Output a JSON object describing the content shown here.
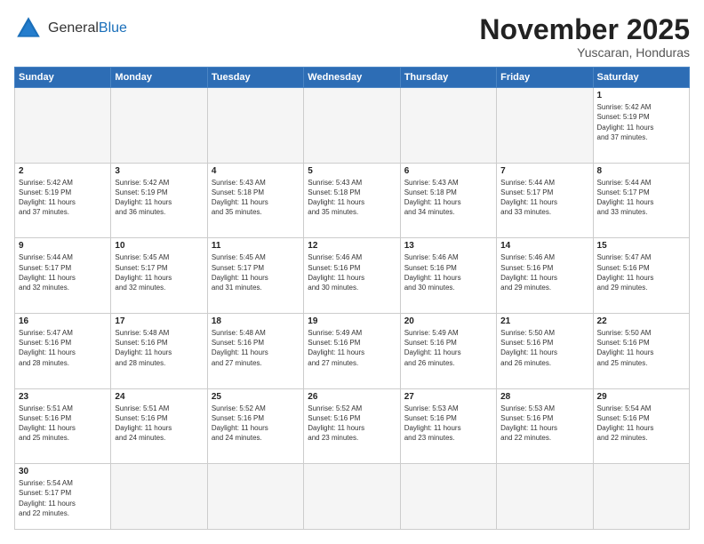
{
  "header": {
    "logo_general": "General",
    "logo_blue": "Blue",
    "month_title": "November 2025",
    "location": "Yuscaran, Honduras"
  },
  "days_of_week": [
    "Sunday",
    "Monday",
    "Tuesday",
    "Wednesday",
    "Thursday",
    "Friday",
    "Saturday"
  ],
  "weeks": [
    [
      {
        "day": "",
        "info": ""
      },
      {
        "day": "",
        "info": ""
      },
      {
        "day": "",
        "info": ""
      },
      {
        "day": "",
        "info": ""
      },
      {
        "day": "",
        "info": ""
      },
      {
        "day": "",
        "info": ""
      },
      {
        "day": "1",
        "info": "Sunrise: 5:42 AM\nSunset: 5:19 PM\nDaylight: 11 hours\nand 37 minutes."
      }
    ],
    [
      {
        "day": "2",
        "info": "Sunrise: 5:42 AM\nSunset: 5:19 PM\nDaylight: 11 hours\nand 37 minutes."
      },
      {
        "day": "3",
        "info": "Sunrise: 5:42 AM\nSunset: 5:19 PM\nDaylight: 11 hours\nand 36 minutes."
      },
      {
        "day": "4",
        "info": "Sunrise: 5:43 AM\nSunset: 5:18 PM\nDaylight: 11 hours\nand 35 minutes."
      },
      {
        "day": "5",
        "info": "Sunrise: 5:43 AM\nSunset: 5:18 PM\nDaylight: 11 hours\nand 35 minutes."
      },
      {
        "day": "6",
        "info": "Sunrise: 5:43 AM\nSunset: 5:18 PM\nDaylight: 11 hours\nand 34 minutes."
      },
      {
        "day": "7",
        "info": "Sunrise: 5:44 AM\nSunset: 5:17 PM\nDaylight: 11 hours\nand 33 minutes."
      },
      {
        "day": "8",
        "info": "Sunrise: 5:44 AM\nSunset: 5:17 PM\nDaylight: 11 hours\nand 33 minutes."
      }
    ],
    [
      {
        "day": "9",
        "info": "Sunrise: 5:44 AM\nSunset: 5:17 PM\nDaylight: 11 hours\nand 32 minutes."
      },
      {
        "day": "10",
        "info": "Sunrise: 5:45 AM\nSunset: 5:17 PM\nDaylight: 11 hours\nand 32 minutes."
      },
      {
        "day": "11",
        "info": "Sunrise: 5:45 AM\nSunset: 5:17 PM\nDaylight: 11 hours\nand 31 minutes."
      },
      {
        "day": "12",
        "info": "Sunrise: 5:46 AM\nSunset: 5:16 PM\nDaylight: 11 hours\nand 30 minutes."
      },
      {
        "day": "13",
        "info": "Sunrise: 5:46 AM\nSunset: 5:16 PM\nDaylight: 11 hours\nand 30 minutes."
      },
      {
        "day": "14",
        "info": "Sunrise: 5:46 AM\nSunset: 5:16 PM\nDaylight: 11 hours\nand 29 minutes."
      },
      {
        "day": "15",
        "info": "Sunrise: 5:47 AM\nSunset: 5:16 PM\nDaylight: 11 hours\nand 29 minutes."
      }
    ],
    [
      {
        "day": "16",
        "info": "Sunrise: 5:47 AM\nSunset: 5:16 PM\nDaylight: 11 hours\nand 28 minutes."
      },
      {
        "day": "17",
        "info": "Sunrise: 5:48 AM\nSunset: 5:16 PM\nDaylight: 11 hours\nand 28 minutes."
      },
      {
        "day": "18",
        "info": "Sunrise: 5:48 AM\nSunset: 5:16 PM\nDaylight: 11 hours\nand 27 minutes."
      },
      {
        "day": "19",
        "info": "Sunrise: 5:49 AM\nSunset: 5:16 PM\nDaylight: 11 hours\nand 27 minutes."
      },
      {
        "day": "20",
        "info": "Sunrise: 5:49 AM\nSunset: 5:16 PM\nDaylight: 11 hours\nand 26 minutes."
      },
      {
        "day": "21",
        "info": "Sunrise: 5:50 AM\nSunset: 5:16 PM\nDaylight: 11 hours\nand 26 minutes."
      },
      {
        "day": "22",
        "info": "Sunrise: 5:50 AM\nSunset: 5:16 PM\nDaylight: 11 hours\nand 25 minutes."
      }
    ],
    [
      {
        "day": "23",
        "info": "Sunrise: 5:51 AM\nSunset: 5:16 PM\nDaylight: 11 hours\nand 25 minutes."
      },
      {
        "day": "24",
        "info": "Sunrise: 5:51 AM\nSunset: 5:16 PM\nDaylight: 11 hours\nand 24 minutes."
      },
      {
        "day": "25",
        "info": "Sunrise: 5:52 AM\nSunset: 5:16 PM\nDaylight: 11 hours\nand 24 minutes."
      },
      {
        "day": "26",
        "info": "Sunrise: 5:52 AM\nSunset: 5:16 PM\nDaylight: 11 hours\nand 23 minutes."
      },
      {
        "day": "27",
        "info": "Sunrise: 5:53 AM\nSunset: 5:16 PM\nDaylight: 11 hours\nand 23 minutes."
      },
      {
        "day": "28",
        "info": "Sunrise: 5:53 AM\nSunset: 5:16 PM\nDaylight: 11 hours\nand 22 minutes."
      },
      {
        "day": "29",
        "info": "Sunrise: 5:54 AM\nSunset: 5:16 PM\nDaylight: 11 hours\nand 22 minutes."
      }
    ],
    [
      {
        "day": "30",
        "info": "Sunrise: 5:54 AM\nSunset: 5:17 PM\nDaylight: 11 hours\nand 22 minutes."
      },
      {
        "day": "",
        "info": ""
      },
      {
        "day": "",
        "info": ""
      },
      {
        "day": "",
        "info": ""
      },
      {
        "day": "",
        "info": ""
      },
      {
        "day": "",
        "info": ""
      },
      {
        "day": "",
        "info": ""
      }
    ]
  ]
}
